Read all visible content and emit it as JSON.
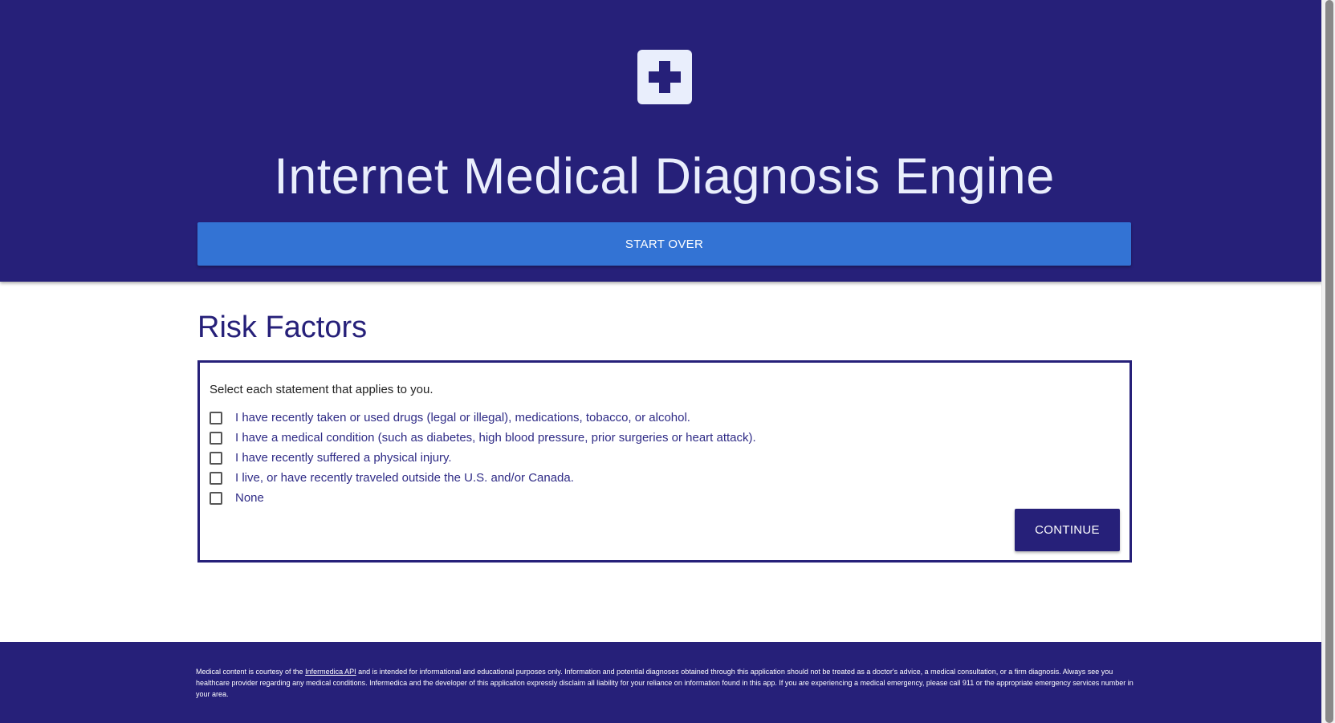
{
  "header": {
    "logo_icon": "medical-cross-icon",
    "title": "Internet Medical Diagnosis Engine",
    "start_over_label": "START OVER"
  },
  "section": {
    "title": "Risk Factors"
  },
  "form": {
    "instructions": "Select each statement that applies to you.",
    "options": [
      {
        "label": "I have recently taken or used drugs (legal or illegal), medications, tobacco, or alcohol.",
        "checked": false
      },
      {
        "label": "I have a medical condition (such as diabetes, high blood pressure, prior surgeries or heart attack).",
        "checked": false
      },
      {
        "label": "I have recently suffered a physical injury.",
        "checked": false
      },
      {
        "label": "I live, or have recently traveled outside the U.S. and/or Canada.",
        "checked": false
      },
      {
        "label": "None",
        "checked": false
      }
    ],
    "continue_label": "CONTINUE"
  },
  "footer": {
    "disclaimer_prefix": "Medical content is courtesy of the ",
    "disclaimer_link": "Infermedica API",
    "disclaimer_suffix": " and is intended for informational and educational purposes only. Information and potential diagnoses obtained through this application should not be treated as a doctor's advice, a medical consultation, or a firm diagnosis. Always see you healthcare provider regarding any medical conditions. Infermedica and the developer of this application expressly disclaim all liability for your reliance on information found in this app. If you are experiencing a medical emergency, please call 911 or the appropriate emergency services number in your area."
  },
  "colors": {
    "primary": "#262079",
    "accent": "#3373d4",
    "light": "#e9eefc"
  }
}
